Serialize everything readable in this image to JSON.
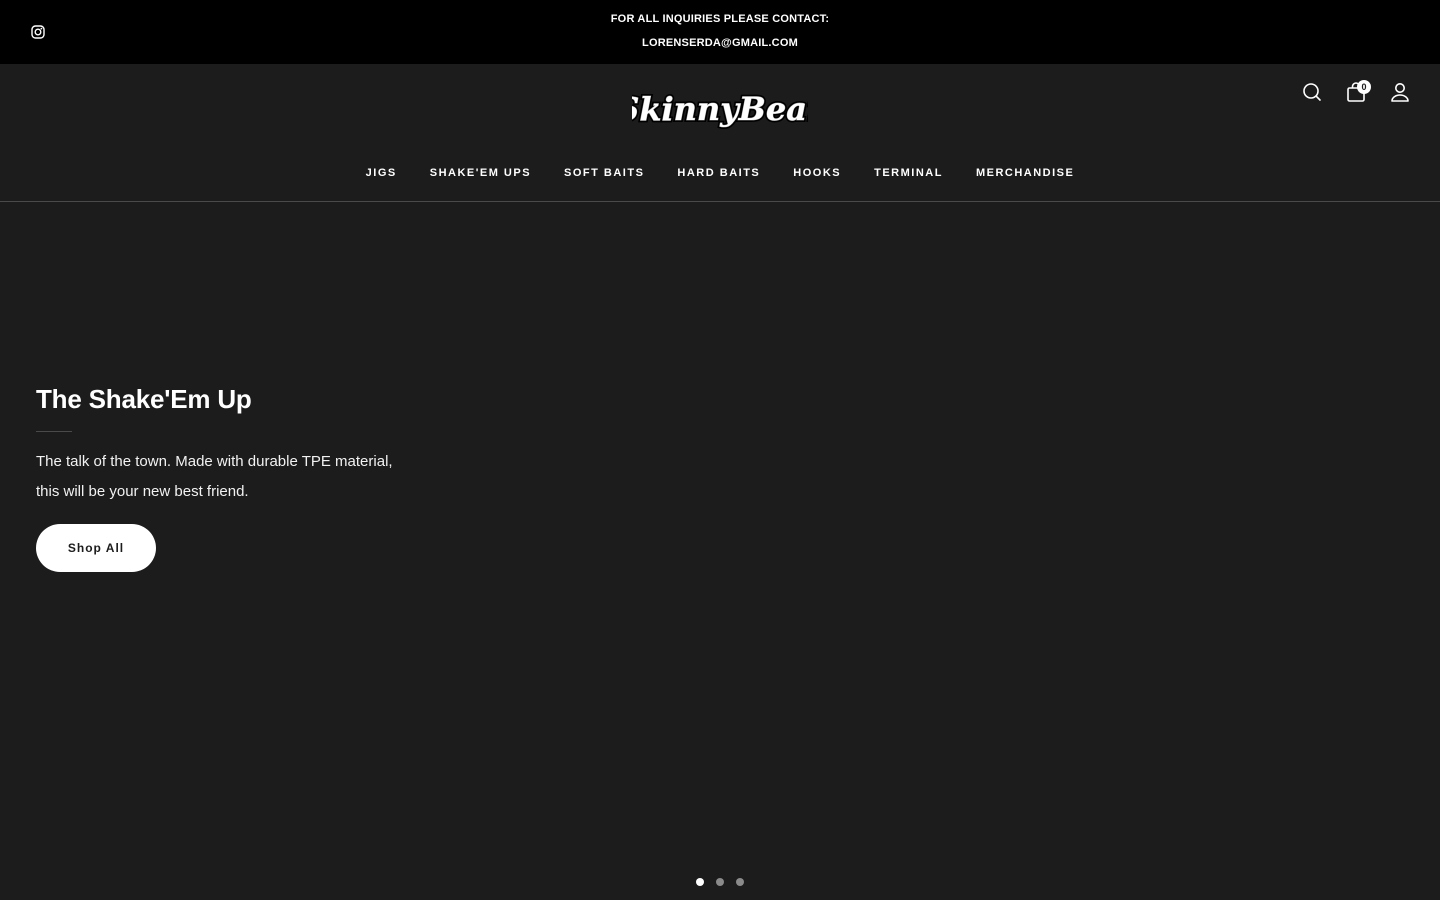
{
  "announcement": {
    "line1": "FOR ALL INQUIRIES PLEASE CONTACT:",
    "line2": "LORENSERDA@GMAIL.COM",
    "social_icon": "instagram-icon"
  },
  "header": {
    "logo_text": "SkinnyBear",
    "cart_count": "0",
    "icons": [
      "search-icon",
      "cart-icon",
      "account-icon"
    ]
  },
  "nav": {
    "items": [
      {
        "label": "JIGS"
      },
      {
        "label": "SHAKE'EM UPS"
      },
      {
        "label": "SOFT BAITS"
      },
      {
        "label": "HARD BAITS"
      },
      {
        "label": "HOOKS"
      },
      {
        "label": "TERMINAL"
      },
      {
        "label": "MERCHANDISE"
      }
    ]
  },
  "hero": {
    "title": "The Shake'Em Up",
    "description_line1": "The talk of the town. Made with durable TPE material,",
    "description_line2": "this will be your new best friend.",
    "cta_label": "Shop All",
    "slide_count": 3,
    "active_slide": 1
  },
  "colors": {
    "background": "#1c1c1c",
    "announcement_bar": "#000000",
    "text": "#ffffff",
    "button_bg": "#ffffff",
    "button_text": "#1c1c1c"
  }
}
